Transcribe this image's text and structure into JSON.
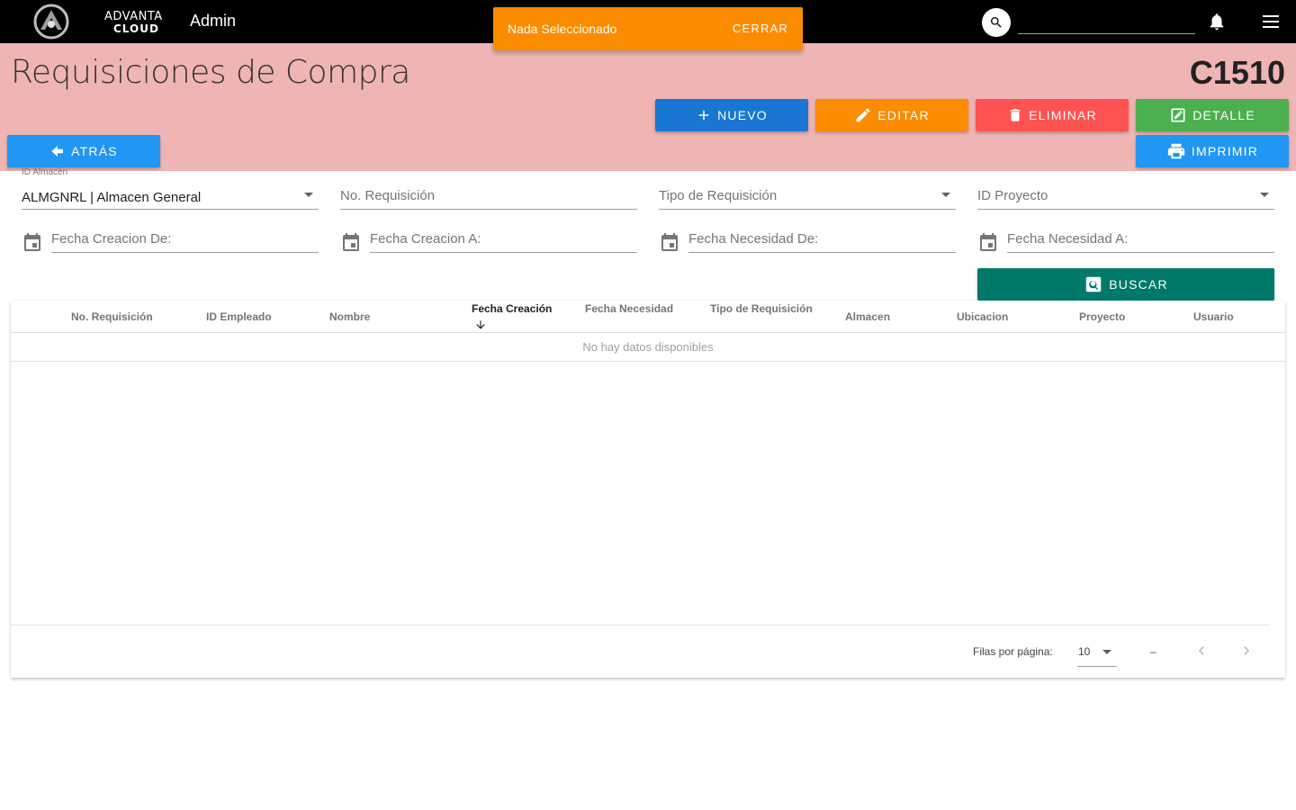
{
  "topbar": {
    "logo_line1": "ADVANTA",
    "logo_line2": "CLOUD",
    "title": "Admin",
    "search_value": ""
  },
  "snackbar": {
    "message": "Nada Seleccionado",
    "close_label": "CERRAR",
    "color": "#fb8c00"
  },
  "header": {
    "title": "Requisiciones de Compra",
    "code": "C1510",
    "background": "#efb4b4"
  },
  "actions": {
    "nuevo": "NUEVO",
    "editar": "EDITAR",
    "eliminar": "ELIMINAR",
    "detalle": "DETALLE",
    "imprimir": "IMPRIMIR",
    "atras": "ATRÁS"
  },
  "filters": {
    "almacen": {
      "label": "ID Almacén",
      "value": "ALMGNRL | Almacen General"
    },
    "no_requisicion": {
      "placeholder": "No. Requisición"
    },
    "tipo_requisicion": {
      "placeholder": "Tipo de Requisición"
    },
    "id_proyecto": {
      "placeholder": "ID Proyecto"
    },
    "fecha_creacion_de": {
      "placeholder": "Fecha Creacion De:"
    },
    "fecha_creacion_a": {
      "placeholder": "Fecha Creacion A:"
    },
    "fecha_necesidad_de": {
      "placeholder": "Fecha Necesidad De:"
    },
    "fecha_necesidad_a": {
      "placeholder": "Fecha Necesidad A:"
    },
    "buscar": "BUSCAR"
  },
  "table": {
    "columns": [
      "No. Requisición",
      "ID Empleado",
      "Nombre",
      "Fecha Creación",
      "Fecha Necesidad",
      "Tipo de Requisición",
      "Almacen",
      "Ubicacion",
      "Proyecto",
      "Usuario"
    ],
    "sorted_column": "Fecha Creación",
    "sort_direction": "desc",
    "empty_message": "No hay datos disponibles",
    "rows": []
  },
  "pagination": {
    "rows_per_page_label": "Filas por página:",
    "rows_per_page": "10",
    "range": "–"
  },
  "colors": {
    "nuevo": "#1976d2",
    "editar": "#fb8c00",
    "eliminar": "#ff5252",
    "detalle": "#4caf50",
    "imprimir": "#2196f3",
    "atras": "#2196f3",
    "buscar": "#00796b"
  }
}
